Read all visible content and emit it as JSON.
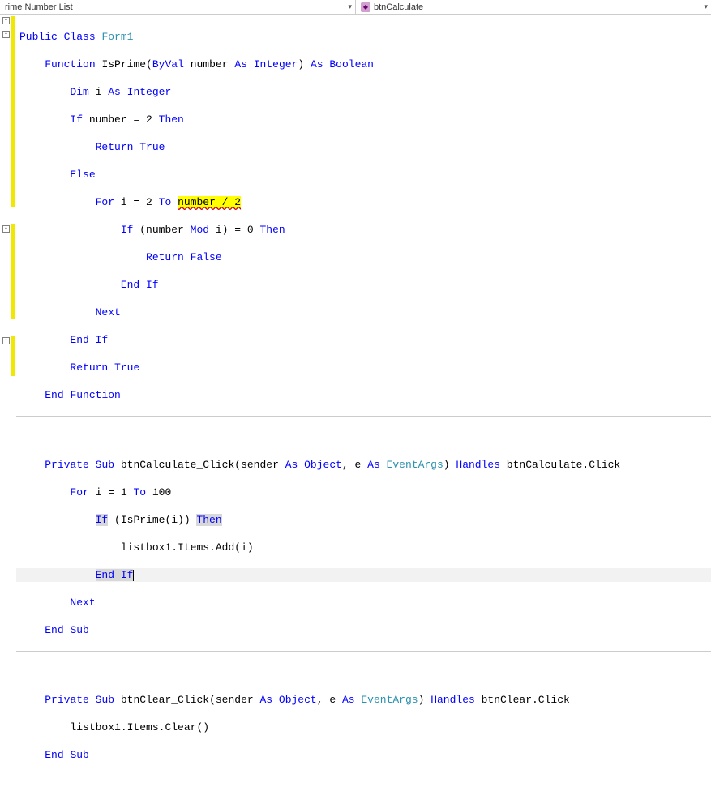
{
  "toolbar": {
    "scope_dropdown": "rime Number List",
    "member_dropdown": "btnCalculate"
  },
  "code": {
    "l1_public": "Public",
    "l1_class": "Class",
    "l1_name": "Form1",
    "l2_function": "Function",
    "l2_name": "IsPrime(",
    "l2_byval": "ByVal",
    "l2_param": " number ",
    "l2_as": "As",
    "l2_integer": "Integer",
    "l2_close": ") ",
    "l2_as2": "As",
    "l2_boolean": "Boolean",
    "l3_dim": "Dim",
    "l3_i": " i ",
    "l3_as": "As",
    "l3_integer": "Integer",
    "l4_if": "If",
    "l4_cond": " number = 2 ",
    "l4_then": "Then",
    "l5_return": "Return",
    "l5_true": "True",
    "l6_else": "Else",
    "l7_for": "For",
    "l7_expr": " i = 2 ",
    "l7_to": "To",
    "l7_hl": "number / 2",
    "l8_if": "If",
    "l8_open": " (number ",
    "l8_mod": "Mod",
    "l8_rest": " i) = 0 ",
    "l8_then": "Then",
    "l9_return": "Return",
    "l9_false": "False",
    "l10_end": "End",
    "l10_if": "If",
    "l11_next": "Next",
    "l12_end": "End",
    "l12_if": "If",
    "l13_return": "Return",
    "l13_true": "True",
    "l14_end": "End",
    "l14_function": "Function",
    "l16_private": "Private",
    "l16_sub": "Sub",
    "l16_name": " btnCalculate_Click(sender ",
    "l16_as": "As",
    "l16_object": "Object",
    "l16_mid": ", e ",
    "l16_as2": "As",
    "l16_eventargs": "EventArgs",
    "l16_close": ") ",
    "l16_handles": "Handles",
    "l16_rest": " btnCalculate.Click",
    "l17_for": "For",
    "l17_expr": " i = 1 ",
    "l17_to": "To",
    "l17_num": " 100",
    "l18_if": "If",
    "l18_expr": " (IsPrime(i)) ",
    "l18_then": "Then",
    "l19_call": "listbox1.Items.Add(i)",
    "l20_end": "End",
    "l20_if": "If",
    "l21_next": "Next",
    "l22_end": "End",
    "l22_sub": "Sub",
    "l24_private": "Private",
    "l24_sub": "Sub",
    "l24_name": " btnClear_Click(sender ",
    "l24_as": "As",
    "l24_object": "Object",
    "l24_mid": ", e ",
    "l24_as2": "As",
    "l24_eventargs": "EventArgs",
    "l24_close": ") ",
    "l24_handles": "Handles",
    "l24_rest": " btnClear.Click",
    "l25_call": "listbox1.Items.Clear()",
    "l26_end": "End",
    "l26_sub": "Sub"
  }
}
